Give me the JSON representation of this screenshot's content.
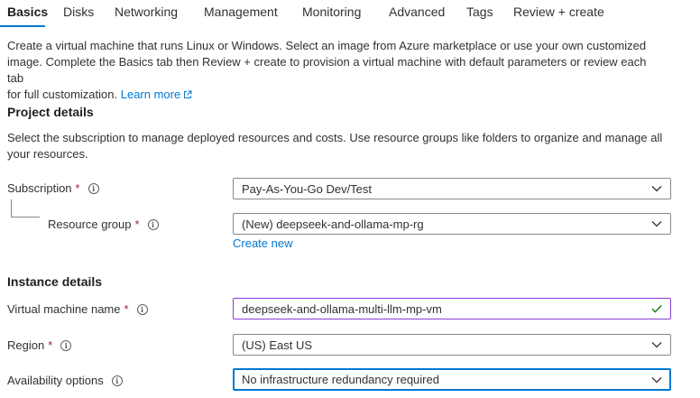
{
  "tabs": [
    {
      "label": "Basics",
      "active": true
    },
    {
      "label": "Disks"
    },
    {
      "label": "Networking"
    },
    {
      "label": "Management"
    },
    {
      "label": "Monitoring"
    },
    {
      "label": "Advanced"
    },
    {
      "label": "Tags"
    },
    {
      "label": "Review + create"
    }
  ],
  "intro": {
    "line1": "Create a virtual machine that runs Linux or Windows. Select an image from Azure marketplace or use your own customized",
    "line2": "image. Complete the Basics tab then Review + create to provision a virtual machine with default parameters or review each tab",
    "line3": "for full customization.",
    "learn_more": "Learn more"
  },
  "project": {
    "title": "Project details",
    "desc_line1": "Select the subscription to manage deployed resources and costs. Use resource groups like folders to organize and manage all",
    "desc_line2": "your resources.",
    "subscription": {
      "label": "Subscription",
      "required": "*",
      "value": "Pay-As-You-Go Dev/Test"
    },
    "resource_group": {
      "label": "Resource group",
      "required": "*",
      "value": "(New) deepseek-and-ollama-mp-rg",
      "create_new": "Create new"
    }
  },
  "instance": {
    "title": "Instance details",
    "vm_name": {
      "label": "Virtual machine name",
      "required": "*",
      "value": "deepseek-and-ollama-multi-llm-mp-vm"
    },
    "region": {
      "label": "Region",
      "required": "*",
      "value": "(US) East US"
    },
    "availability": {
      "label": "Availability options",
      "value": "No infrastructure redundancy required"
    }
  },
  "icons": {
    "info": "i"
  },
  "colors": {
    "accent": "#0078d4",
    "required": "#a4262c",
    "valid_check": "#107c10",
    "valid_border": "#8a3dd6"
  }
}
